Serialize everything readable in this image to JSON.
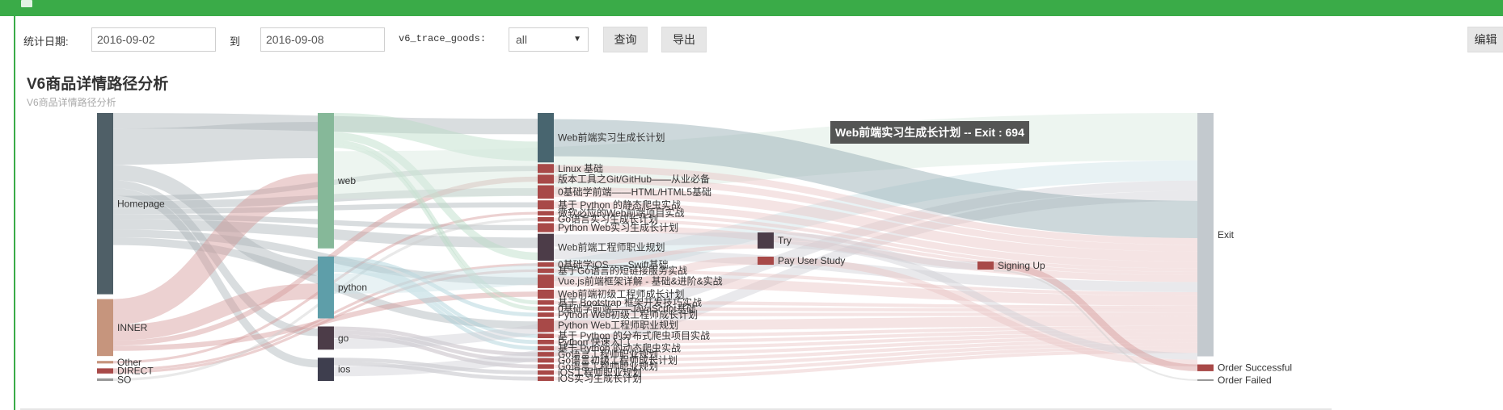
{
  "toolbar": {
    "date_label": "统计日期:",
    "start_date": "2016-09-02",
    "to_label": "到",
    "end_date": "2016-09-08",
    "goods_label": "v6_trace_goods:",
    "goods_selected": "all",
    "query_label": "查询",
    "export_label": "导出",
    "edit_label": "编辑"
  },
  "title": "V6商品详情路径分析",
  "subtitle": "V6商品详情路径分析",
  "tooltip": "Web前端实习生成长计划 -- Exit : 694",
  "chart_data": {
    "type": "sankey",
    "nodes": [
      {
        "id": "homepage",
        "label": "Homepage",
        "col": 0,
        "value": 70,
        "color": "#4f5f67"
      },
      {
        "id": "inner",
        "label": "INNER",
        "col": 0,
        "value": 22,
        "color": "#c6957d"
      },
      {
        "id": "other",
        "label": "Other",
        "col": 0,
        "value": 1,
        "color": "#c6957d"
      },
      {
        "id": "direct",
        "label": "DIRECT",
        "col": 0,
        "value": 2,
        "color": "#a84948"
      },
      {
        "id": "so",
        "label": "SO",
        "col": 0,
        "value": 1,
        "color": "#999999"
      },
      {
        "id": "web",
        "label": "web",
        "col": 1,
        "value": 35,
        "color": "#86b899"
      },
      {
        "id": "python",
        "label": "python",
        "col": 1,
        "value": 16,
        "color": "#5e9ea9"
      },
      {
        "id": "go",
        "label": "go",
        "col": 1,
        "value": 6,
        "color": "#4c3c48"
      },
      {
        "id": "ios",
        "label": "ios",
        "col": 1,
        "value": 6,
        "color": "#3e3e4e"
      },
      {
        "id": "c1",
        "label": "Web前端实习生成长计划",
        "col": 2,
        "value": 11,
        "color": "#48656f"
      },
      {
        "id": "c2",
        "label": "Linux 基础",
        "col": 2,
        "value": 2,
        "color": "#a84948"
      },
      {
        "id": "c3",
        "label": "版本工具之Git/GitHub——从业必备",
        "col": 2,
        "value": 2,
        "color": "#a84948"
      },
      {
        "id": "c4",
        "label": "0基础学前端——HTML/HTML5基础",
        "col": 2,
        "value": 3,
        "color": "#a84948"
      },
      {
        "id": "c5",
        "label": "基于 Python 的静态爬虫实战",
        "col": 2,
        "value": 2,
        "color": "#a84948"
      },
      {
        "id": "c6",
        "label": "微软必应的Web前端项目实战",
        "col": 2,
        "value": 1,
        "color": "#a84948"
      },
      {
        "id": "c7",
        "label": "Go语言实习生成长计划",
        "col": 2,
        "value": 1,
        "color": "#a84948"
      },
      {
        "id": "c8",
        "label": "Python Web实习生成长计划",
        "col": 2,
        "value": 2,
        "color": "#a84948"
      },
      {
        "id": "c9",
        "label": "Web前端工程师职业规划",
        "col": 2,
        "value": 6,
        "color": "#4c3c48"
      },
      {
        "id": "c10",
        "label": "0基础学iOS——Swift基础",
        "col": 2,
        "value": 1,
        "color": "#a84948"
      },
      {
        "id": "c11",
        "label": "基于Go语言的短链接服务实战",
        "col": 2,
        "value": 1,
        "color": "#a84948"
      },
      {
        "id": "c12",
        "label": "Vue.js前端框架详解 - 基础&进阶&实战",
        "col": 2,
        "value": 3,
        "color": "#a84948"
      },
      {
        "id": "c13",
        "label": "Web前端初级工程师成长计划",
        "col": 2,
        "value": 2,
        "color": "#a84948"
      },
      {
        "id": "c14",
        "label": "基于 Bootstrap 框架开发技巧实战",
        "col": 2,
        "value": 1,
        "color": "#a84948"
      },
      {
        "id": "c15",
        "label": "0基础学前端——JavaScript基础",
        "col": 2,
        "value": 1,
        "color": "#a84948"
      },
      {
        "id": "c16",
        "label": "Python Web初级工程师成长计划",
        "col": 2,
        "value": 1,
        "color": "#a84948"
      },
      {
        "id": "c17",
        "label": "Python Web工程师职业规划",
        "col": 2,
        "value": 3,
        "color": "#a84948"
      },
      {
        "id": "c18",
        "label": "基于 Python 的分布式爬虫项目实战",
        "col": 2,
        "value": 1,
        "color": "#a84948"
      },
      {
        "id": "c19",
        "label": "Python 快速入门",
        "col": 2,
        "value": 1,
        "color": "#a84948"
      },
      {
        "id": "c20",
        "label": "基于 Python 的动态爬虫实战",
        "col": 2,
        "value": 1,
        "color": "#a84948"
      },
      {
        "id": "c21",
        "label": "Go语言工程师职业规划",
        "col": 2,
        "value": 1,
        "color": "#a84948"
      },
      {
        "id": "c22",
        "label": "Go语言初级工程师成长计划",
        "col": 2,
        "value": 1,
        "color": "#a84948"
      },
      {
        "id": "c23",
        "label": "Go语言工程师职业规划",
        "col": 2,
        "value": 1,
        "color": "#a84948"
      },
      {
        "id": "c24",
        "label": "iOS工程师职业规划",
        "col": 2,
        "value": 1,
        "color": "#a84948"
      },
      {
        "id": "c25",
        "label": "iOS实习生成长计划",
        "col": 2,
        "value": 1,
        "color": "#a84948"
      },
      {
        "id": "try",
        "label": "Try",
        "col": 3,
        "value": 4,
        "color": "#4c3c48"
      },
      {
        "id": "pay",
        "label": "Pay User Study",
        "col": 3,
        "value": 2,
        "color": "#a84948"
      },
      {
        "id": "signing",
        "label": "Signing Up",
        "col": 4,
        "value": 2,
        "color": "#a84948"
      },
      {
        "id": "exit",
        "label": "Exit",
        "col": 5,
        "value": 72,
        "color": "#c3c9ce"
      },
      {
        "id": "success",
        "label": "Order Successful",
        "col": 5,
        "value": 2,
        "color": "#a84948"
      },
      {
        "id": "failed",
        "label": "Order Failed",
        "col": 5,
        "value": 0.5,
        "color": "#999999"
      }
    ],
    "links": [
      {
        "source": "homepage",
        "target": "c1",
        "value": 6,
        "color": "#aab3b8"
      },
      {
        "source": "homepage",
        "target": "web",
        "value": 14,
        "color": "#aab3b8"
      },
      {
        "source": "homepage",
        "target": "python",
        "value": 6,
        "color": "#aab3b8"
      },
      {
        "source": "homepage",
        "target": "go",
        "value": 3,
        "color": "#aab3b8"
      },
      {
        "source": "homepage",
        "target": "ios",
        "value": 3,
        "color": "#aab3b8"
      },
      {
        "source": "homepage",
        "target": "c2",
        "value": 2,
        "color": "#aab3b8"
      },
      {
        "source": "homepage",
        "target": "c4",
        "value": 3,
        "color": "#aab3b8"
      },
      {
        "source": "homepage",
        "target": "c5",
        "value": 2,
        "color": "#aab3b8"
      },
      {
        "source": "homepage",
        "target": "c8",
        "value": 2,
        "color": "#aab3b8"
      },
      {
        "source": "homepage",
        "target": "c9",
        "value": 4,
        "color": "#aab3b8"
      },
      {
        "source": "homepage",
        "target": "c12",
        "value": 3,
        "color": "#aab3b8"
      },
      {
        "source": "homepage",
        "target": "c17",
        "value": 3,
        "color": "#aab3b8"
      },
      {
        "source": "inner",
        "target": "web",
        "value": 10,
        "color": "#d59a9a"
      },
      {
        "source": "inner",
        "target": "python",
        "value": 6,
        "color": "#d59a9a"
      },
      {
        "source": "inner",
        "target": "c3",
        "value": 2,
        "color": "#d59a9a"
      },
      {
        "source": "inner",
        "target": "c13",
        "value": 2,
        "color": "#d59a9a"
      },
      {
        "source": "other",
        "target": "c6",
        "value": 1,
        "color": "#d59a9a"
      },
      {
        "source": "direct",
        "target": "c10",
        "value": 1,
        "color": "#d59a9a"
      },
      {
        "source": "direct",
        "target": "c11",
        "value": 1,
        "color": "#d59a9a"
      },
      {
        "source": "so",
        "target": "c7",
        "value": 1,
        "color": "#cfcfcf"
      },
      {
        "source": "web",
        "target": "c1",
        "value": 5,
        "color": "#b9dbc6"
      },
      {
        "source": "web",
        "target": "c9",
        "value": 2,
        "color": "#b9dbc6"
      },
      {
        "source": "web",
        "target": "c14",
        "value": 1,
        "color": "#b9dbc6"
      },
      {
        "source": "web",
        "target": "c15",
        "value": 1,
        "color": "#b9dbc6"
      },
      {
        "source": "web",
        "target": "exit",
        "value": 14,
        "color": "#d6e9de"
      },
      {
        "source": "python",
        "target": "c16",
        "value": 1,
        "color": "#a6cfd6"
      },
      {
        "source": "python",
        "target": "c18",
        "value": 1,
        "color": "#a6cfd6"
      },
      {
        "source": "python",
        "target": "c19",
        "value": 1,
        "color": "#a6cfd6"
      },
      {
        "source": "python",
        "target": "c20",
        "value": 1,
        "color": "#a6cfd6"
      },
      {
        "source": "python",
        "target": "exit",
        "value": 6,
        "color": "#cde3e7"
      },
      {
        "source": "go",
        "target": "c21",
        "value": 1,
        "color": "#b9b0b7"
      },
      {
        "source": "go",
        "target": "c22",
        "value": 1,
        "color": "#b9b0b7"
      },
      {
        "source": "go",
        "target": "c23",
        "value": 1,
        "color": "#b9b0b7"
      },
      {
        "source": "go",
        "target": "exit",
        "value": 3,
        "color": "#cfcfd4"
      },
      {
        "source": "ios",
        "target": "c24",
        "value": 1,
        "color": "#b5b5bd"
      },
      {
        "source": "ios",
        "target": "c25",
        "value": 1,
        "color": "#b5b5bd"
      },
      {
        "source": "ios",
        "target": "exit",
        "value": 3,
        "color": "#cfcfd4"
      },
      {
        "source": "c1",
        "target": "exit",
        "value": 11,
        "color": "#90a8b0"
      },
      {
        "source": "c2",
        "target": "exit",
        "value": 2,
        "color": "#e8c4c4"
      },
      {
        "source": "c3",
        "target": "exit",
        "value": 2,
        "color": "#e8c4c4"
      },
      {
        "source": "c4",
        "target": "exit",
        "value": 3,
        "color": "#e8c4c4"
      },
      {
        "source": "c5",
        "target": "exit",
        "value": 2,
        "color": "#e8c4c4"
      },
      {
        "source": "c6",
        "target": "exit",
        "value": 1,
        "color": "#e8c4c4"
      },
      {
        "source": "c7",
        "target": "exit",
        "value": 1,
        "color": "#e8c4c4"
      },
      {
        "source": "c8",
        "target": "exit",
        "value": 2,
        "color": "#e8c4c4"
      },
      {
        "source": "c9",
        "target": "try",
        "value": 3,
        "color": "#cfcfd4"
      },
      {
        "source": "c9",
        "target": "exit",
        "value": 3,
        "color": "#cfcfd4"
      },
      {
        "source": "c10",
        "target": "try",
        "value": 1,
        "color": "#e8c4c4"
      },
      {
        "source": "c11",
        "target": "exit",
        "value": 1,
        "color": "#e8c4c4"
      },
      {
        "source": "c12",
        "target": "exit",
        "value": 3,
        "color": "#e8c4c4"
      },
      {
        "source": "c13",
        "target": "pay",
        "value": 2,
        "color": "#e8c4c4"
      },
      {
        "source": "c14",
        "target": "exit",
        "value": 1,
        "color": "#e8c4c4"
      },
      {
        "source": "c15",
        "target": "exit",
        "value": 1,
        "color": "#e8c4c4"
      },
      {
        "source": "c16",
        "target": "exit",
        "value": 1,
        "color": "#e8c4c4"
      },
      {
        "source": "c17",
        "target": "exit",
        "value": 3,
        "color": "#e8c4c4"
      },
      {
        "source": "c18",
        "target": "exit",
        "value": 1,
        "color": "#e8c4c4"
      },
      {
        "source": "c19",
        "target": "exit",
        "value": 1,
        "color": "#e8c4c4"
      },
      {
        "source": "c20",
        "target": "exit",
        "value": 1,
        "color": "#e8c4c4"
      },
      {
        "source": "c21",
        "target": "exit",
        "value": 1,
        "color": "#e8c4c4"
      },
      {
        "source": "c22",
        "target": "exit",
        "value": 1,
        "color": "#e8c4c4"
      },
      {
        "source": "c23",
        "target": "exit",
        "value": 1,
        "color": "#e8c4c4"
      },
      {
        "source": "c24",
        "target": "exit",
        "value": 1,
        "color": "#e8c4c4"
      },
      {
        "source": "c25",
        "target": "exit",
        "value": 1,
        "color": "#e8c4c4"
      },
      {
        "source": "try",
        "target": "signing",
        "value": 2,
        "color": "#cfcfd4"
      },
      {
        "source": "try",
        "target": "exit",
        "value": 2,
        "color": "#cfcfd4"
      },
      {
        "source": "pay",
        "target": "exit",
        "value": 2,
        "color": "#e8c4c4"
      },
      {
        "source": "signing",
        "target": "success",
        "value": 2,
        "color": "#d59a9a"
      },
      {
        "source": "signing",
        "target": "failed",
        "value": 0.5,
        "color": "#cfcfcf"
      }
    ]
  }
}
